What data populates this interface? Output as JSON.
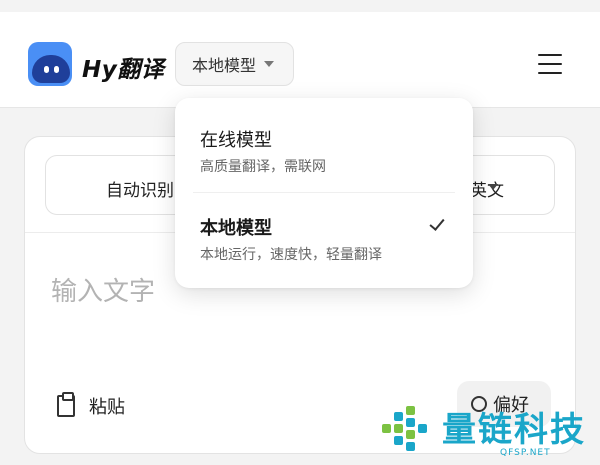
{
  "app": {
    "title": "Hy翻译"
  },
  "header": {
    "model_selector": {
      "label": "本地模型"
    },
    "menu_icon": "hamburger-menu-icon"
  },
  "translator": {
    "source_language": "自动识别",
    "target_language": "英文",
    "input_placeholder": "输入文字",
    "paste_label": "粘贴",
    "preferences_label": "偏好"
  },
  "model_dropdown": {
    "options": [
      {
        "title": "在线模型",
        "description": "高质量翻译，需联网",
        "selected": false
      },
      {
        "title": "本地模型",
        "description": "本地运行，速度快，轻量翻译",
        "selected": true
      }
    ]
  },
  "watermark": {
    "text": "量链科技",
    "subtext": "QFSP.NET"
  },
  "colors": {
    "background": "#f3f3f3",
    "logo": "#4a8ff5",
    "watermark": "#1aa6c9"
  }
}
